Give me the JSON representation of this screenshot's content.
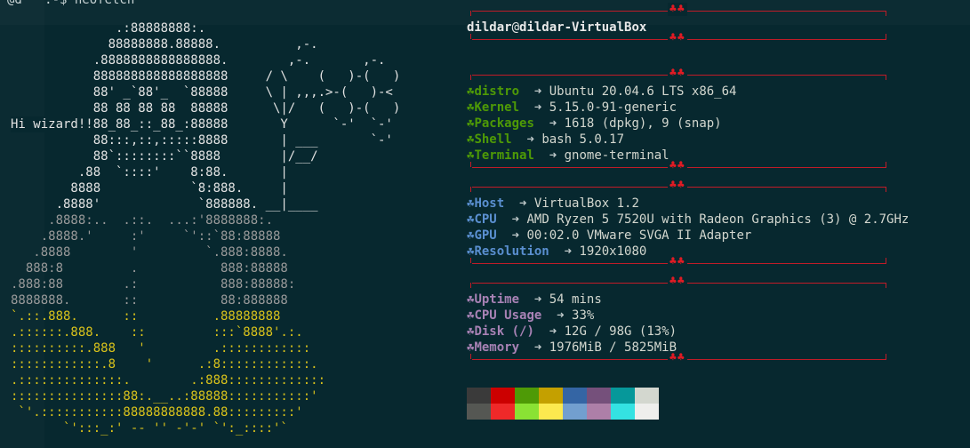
{
  "terminal": {
    "top_prompt": "@d   :-$ neofetch",
    "greeting": "Hi wizard!!"
  },
  "ascii_art": [
    {
      "text": "              .:88888888:.",
      "c": "w"
    },
    {
      "text": "             88888888.88888.          ,-.",
      "c": "w"
    },
    {
      "text": "           .8888888888888888.        ,-.       ,-.",
      "c": "w"
    },
    {
      "text": "           888888888888888888     / \\    (   )-(   )",
      "c": "w"
    },
    {
      "text": "           88' _`88'_  `88888     \\ | ,,,.>-(   )-<",
      "c": "w"
    },
    {
      "text": "           88 88 88 88  88888      \\|/   (   )-(   )",
      "c": "w"
    },
    {
      "text": "           88_88_::_88_:88888       Y      `-'  `-'",
      "c": "w"
    },
    {
      "text": "           88:::,::,:::::8888       | ___       `-'",
      "c": "w"
    },
    {
      "text": "           88`::::::::``8888        |/__/",
      "c": "w"
    },
    {
      "text": "         .88  `::::'    8:88.       |",
      "c": "w"
    },
    {
      "text": "        8888            `8:888.     |",
      "c": "w"
    },
    {
      "text": "      .8888'             `888888. __|____",
      "c": "w"
    },
    {
      "text": "     .8888:..  .::.  ...:'8888888:.",
      "c": "g"
    },
    {
      "text": "    .8888.'     :'     `'::`88:88888",
      "c": "g"
    },
    {
      "text": "   .8888        '         `.888:8888.",
      "c": "g"
    },
    {
      "text": "  888:8         .           888:88888",
      "c": "g"
    },
    {
      "text": ".888:88        .:           888:88888:",
      "c": "g"
    },
    {
      "text": "8888888.       ::           88:888888",
      "c": "g"
    },
    {
      "text": "`.::.888.      ::          .88888888",
      "c": "y"
    },
    {
      "text": ".::::::.888.    ::         :::`8888'.:.",
      "c": "y"
    },
    {
      "text": "::::::::::.888   '         .::::::::::::",
      "c": "y"
    },
    {
      "text": "::::::::::::.8    '      .:8::::::::::::.",
      "c": "y"
    },
    {
      "text": ".::::::::::::::.        .:888:::::::::::::",
      "c": "y"
    },
    {
      "text": ":::::::::::::::88:.__..:88888:::::::::::'",
      "c": "y"
    },
    {
      "text": " `'.:::::::::::88888888888.88:::::::::'",
      "c": "y"
    },
    {
      "text": "       `':::_:' -- '' -'-' `':_::::'`",
      "c": "y"
    }
  ],
  "info": {
    "user": "dildar",
    "at": "@",
    "host": "dildar-VirtualBox",
    "arrow": "➜",
    "club": "☘",
    "divider_clubs": "♣♣",
    "system": [
      {
        "key": "distro",
        "value": "Ubuntu 20.04.6 LTS x86_64"
      },
      {
        "key": "Kernel",
        "value": "5.15.0-91-generic"
      },
      {
        "key": "Packages",
        "value": "1618 (dpkg), 9 (snap)"
      },
      {
        "key": "Shell",
        "value": "bash 5.0.17"
      },
      {
        "key": "Terminal",
        "value": "gnome-terminal"
      }
    ],
    "hardware": [
      {
        "key": "Host",
        "value": "VirtualBox 1.2"
      },
      {
        "key": "CPU",
        "value": "AMD Ryzen 5 7520U with Radeon Graphics (3) @ 2.7GHz"
      },
      {
        "key": "GPU",
        "value": "00:02.0 VMware SVGA II Adapter"
      },
      {
        "key": "Resolution",
        "value": "1920x1080"
      }
    ],
    "usage": [
      {
        "key": "Uptime",
        "value": "54 mins"
      },
      {
        "key": "CPU Usage",
        "value": "33%"
      },
      {
        "key": "Disk (/)",
        "value": "12G / 98G (13%)"
      },
      {
        "key": "Memory",
        "value": "1976MiB / 5825MiB"
      }
    ]
  },
  "colors": {
    "background": "#07282f",
    "divider": "#c01c28",
    "system_key": "#4e9a06",
    "hardware_key": "#5a8fd0",
    "usage_key": "#a882b5",
    "palette_dark": [
      "#3a3a3a",
      "#cc0000",
      "#4e9a06",
      "#c4a000",
      "#3465a4",
      "#75507b",
      "#06989a",
      "#d3d7cf"
    ],
    "palette_bright": [
      "#555753",
      "#ef2929",
      "#8ae234",
      "#fce94f",
      "#729fcf",
      "#ad7fa8",
      "#34e2e2",
      "#eeeeec"
    ]
  }
}
